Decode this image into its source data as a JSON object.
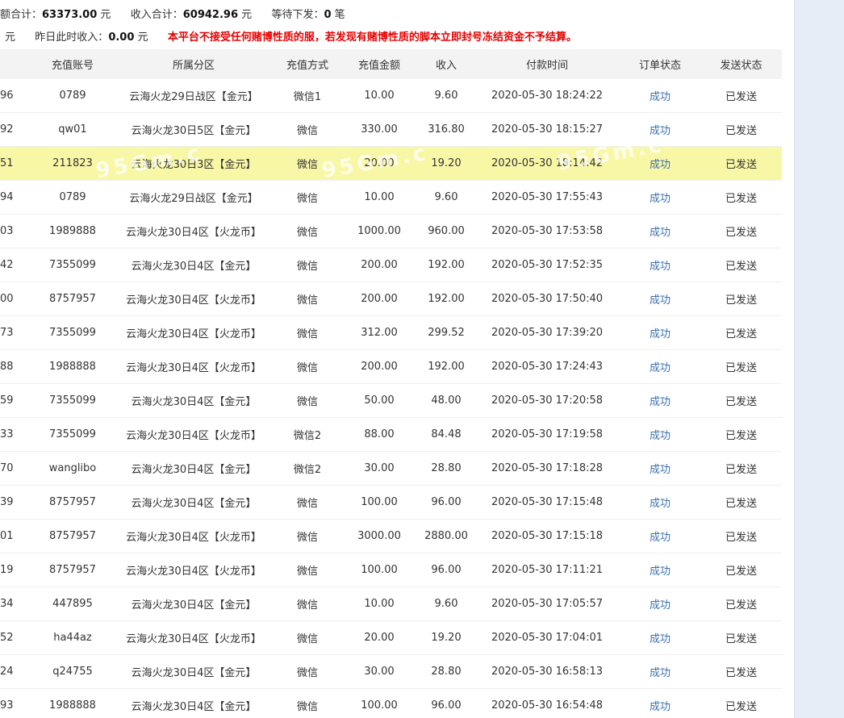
{
  "summary": {
    "total_label": "额合计：",
    "total_value": "63373.00",
    "total_unit": "元",
    "income_label": "收入合计：",
    "income_value": "60942.96",
    "income_unit": "元",
    "pending_label": "等待下发：",
    "pending_value": "0",
    "pending_unit": "笔",
    "row2_left": "元",
    "yesterday_label": "昨日此时收入：",
    "yesterday_value": "0.00",
    "yesterday_unit": "元",
    "notice": "本平台不接受任何赌博性质的服，若发现有赌博性质的脚本立即封号冻结资金不予结算。"
  },
  "table": {
    "headers": [
      "",
      "充值账号",
      "所属分区",
      "充值方式",
      "充值金额",
      "收入",
      "付款时间",
      "订单状态",
      "发送状态"
    ],
    "highlight_row": 2,
    "rows": [
      [
        "96",
        "0789",
        "云海火龙29日战区【金元】",
        "微信1",
        "10.00",
        "9.60",
        "2020-05-30 18:24:22",
        "成功",
        "已发送"
      ],
      [
        "92",
        "qw01",
        "云海火龙30日5区【金元】",
        "微信",
        "330.00",
        "316.80",
        "2020-05-30 18:15:27",
        "成功",
        "已发送"
      ],
      [
        "51",
        "211823",
        "云海火龙30日3区【金元】",
        "微信",
        "20.00",
        "19.20",
        "2020-05-30 18:14:42",
        "成功",
        "已发送"
      ],
      [
        "94",
        "0789",
        "云海火龙29日战区【金元】",
        "微信",
        "10.00",
        "9.60",
        "2020-05-30 17:55:43",
        "成功",
        "已发送"
      ],
      [
        "03",
        "1989888",
        "云海火龙30日4区【火龙币】",
        "微信",
        "1000.00",
        "960.00",
        "2020-05-30 17:53:58",
        "成功",
        "已发送"
      ],
      [
        "42",
        "7355099",
        "云海火龙30日4区【金元】",
        "微信",
        "200.00",
        "192.00",
        "2020-05-30 17:52:35",
        "成功",
        "已发送"
      ],
      [
        "00",
        "8757957",
        "云海火龙30日4区【火龙币】",
        "微信",
        "200.00",
        "192.00",
        "2020-05-30 17:50:40",
        "成功",
        "已发送"
      ],
      [
        "73",
        "7355099",
        "云海火龙30日4区【火龙币】",
        "微信",
        "312.00",
        "299.52",
        "2020-05-30 17:39:20",
        "成功",
        "已发送"
      ],
      [
        "88",
        "1988888",
        "云海火龙30日4区【火龙币】",
        "微信",
        "200.00",
        "192.00",
        "2020-05-30 17:24:43",
        "成功",
        "已发送"
      ],
      [
        "59",
        "7355099",
        "云海火龙30日4区【金元】",
        "微信",
        "50.00",
        "48.00",
        "2020-05-30 17:20:58",
        "成功",
        "已发送"
      ],
      [
        "33",
        "7355099",
        "云海火龙30日4区【火龙币】",
        "微信2",
        "88.00",
        "84.48",
        "2020-05-30 17:19:58",
        "成功",
        "已发送"
      ],
      [
        "70",
        "wanglibo",
        "云海火龙30日4区【金元】",
        "微信2",
        "30.00",
        "28.80",
        "2020-05-30 17:18:28",
        "成功",
        "已发送"
      ],
      [
        "39",
        "8757957",
        "云海火龙30日4区【金元】",
        "微信",
        "100.00",
        "96.00",
        "2020-05-30 17:15:48",
        "成功",
        "已发送"
      ],
      [
        "01",
        "8757957",
        "云海火龙30日4区【火龙币】",
        "微信",
        "3000.00",
        "2880.00",
        "2020-05-30 17:15:18",
        "成功",
        "已发送"
      ],
      [
        "19",
        "8757957",
        "云海火龙30日4区【火龙币】",
        "微信",
        "100.00",
        "96.00",
        "2020-05-30 17:11:21",
        "成功",
        "已发送"
      ],
      [
        "34",
        "447895",
        "云海火龙30日4区【金元】",
        "微信",
        "10.00",
        "9.60",
        "2020-05-30 17:05:57",
        "成功",
        "已发送"
      ],
      [
        "52",
        "ha44az",
        "云海火龙30日4区【火龙币】",
        "微信",
        "20.00",
        "19.20",
        "2020-05-30 17:04:01",
        "成功",
        "已发送"
      ],
      [
        "24",
        "q24755",
        "云海火龙30日4区【金元】",
        "微信",
        "30.00",
        "28.80",
        "2020-05-30 16:58:13",
        "成功",
        "已发送"
      ],
      [
        "93",
        "1988888",
        "云海火龙30日4区【金元】",
        "微信",
        "100.00",
        "96.00",
        "2020-05-30 16:54:48",
        "成功",
        "已发送"
      ]
    ]
  },
  "watermark": "95Gm.c",
  "colors": {
    "notice": "#e60000",
    "status_link": "#3a6fb0",
    "highlight_row_bg": "#f8f7a6",
    "header_bg": "#f3f3f3"
  }
}
